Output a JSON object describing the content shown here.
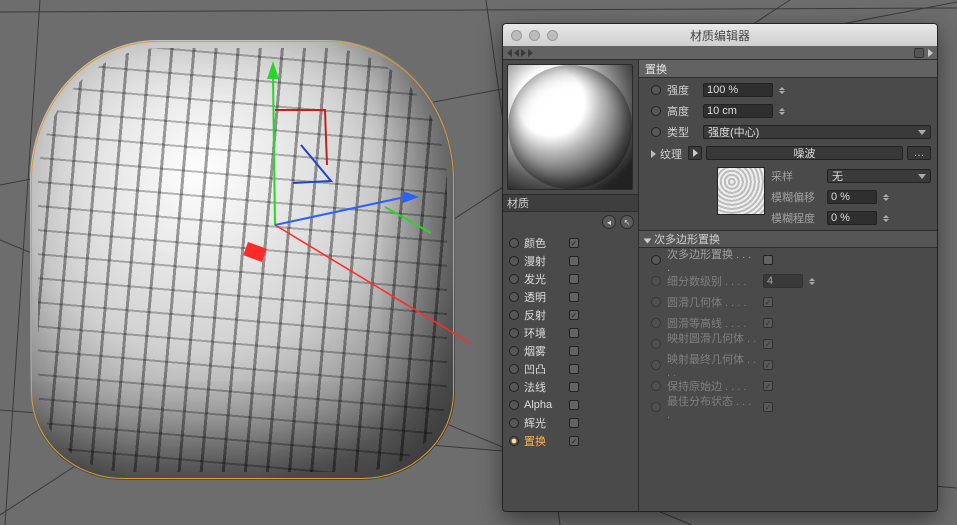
{
  "window": {
    "title": "材质编辑器"
  },
  "material": {
    "name": "材质"
  },
  "channels": [
    {
      "key": "color",
      "label": "颜色",
      "checked": true,
      "selected": false
    },
    {
      "key": "diffuse",
      "label": "漫射",
      "checked": false,
      "selected": false
    },
    {
      "key": "lumin",
      "label": "发光",
      "checked": false,
      "selected": false
    },
    {
      "key": "transp",
      "label": "透明",
      "checked": false,
      "selected": false
    },
    {
      "key": "reflect",
      "label": "反射",
      "checked": true,
      "selected": false
    },
    {
      "key": "env",
      "label": "环境",
      "checked": false,
      "selected": false
    },
    {
      "key": "fog",
      "label": "烟雾",
      "checked": false,
      "selected": false
    },
    {
      "key": "bump",
      "label": "凹凸",
      "checked": false,
      "selected": false
    },
    {
      "key": "normal",
      "label": "法线",
      "checked": false,
      "selected": false
    },
    {
      "key": "alpha",
      "label": "Alpha",
      "checked": false,
      "selected": false
    },
    {
      "key": "glow",
      "label": "辉光",
      "checked": false,
      "selected": false
    },
    {
      "key": "displace",
      "label": "置换",
      "checked": true,
      "selected": true
    }
  ],
  "disp": {
    "title": "置换",
    "strength_label": "强度",
    "strength_value": "100 %",
    "height_label": "高度",
    "height_value": "10 cm",
    "type_label": "类型",
    "type_value": "强度(中心)",
    "texture_label": "纹理",
    "texture_button": "噪波",
    "sample_label": "采样",
    "sample_value": "无",
    "blur_offset_label": "模糊偏移",
    "blur_offset_value": "0 %",
    "blur_scale_label": "模糊程度",
    "blur_scale_value": "0 %"
  },
  "subpoly": {
    "title": "次多边形置换",
    "rows": [
      {
        "label": "次多边形置换",
        "checked": false,
        "enabled": true,
        "hasField": false
      },
      {
        "label": "细分数级别",
        "value": "4",
        "enabled": false,
        "hasField": true
      },
      {
        "label": "圆滑几何体",
        "checked": true,
        "enabled": false,
        "hasField": false
      },
      {
        "label": "圆滑等高线",
        "checked": true,
        "enabled": false,
        "hasField": false
      },
      {
        "label": "映射圆滑几何体",
        "checked": true,
        "enabled": false,
        "hasField": false
      },
      {
        "label": "映射最终几何体",
        "checked": true,
        "enabled": false,
        "hasField": false
      },
      {
        "label": "保持原始边",
        "checked": true,
        "enabled": false,
        "hasField": false
      },
      {
        "label": "最佳分布状态",
        "checked": true,
        "enabled": false,
        "hasField": false
      }
    ]
  }
}
